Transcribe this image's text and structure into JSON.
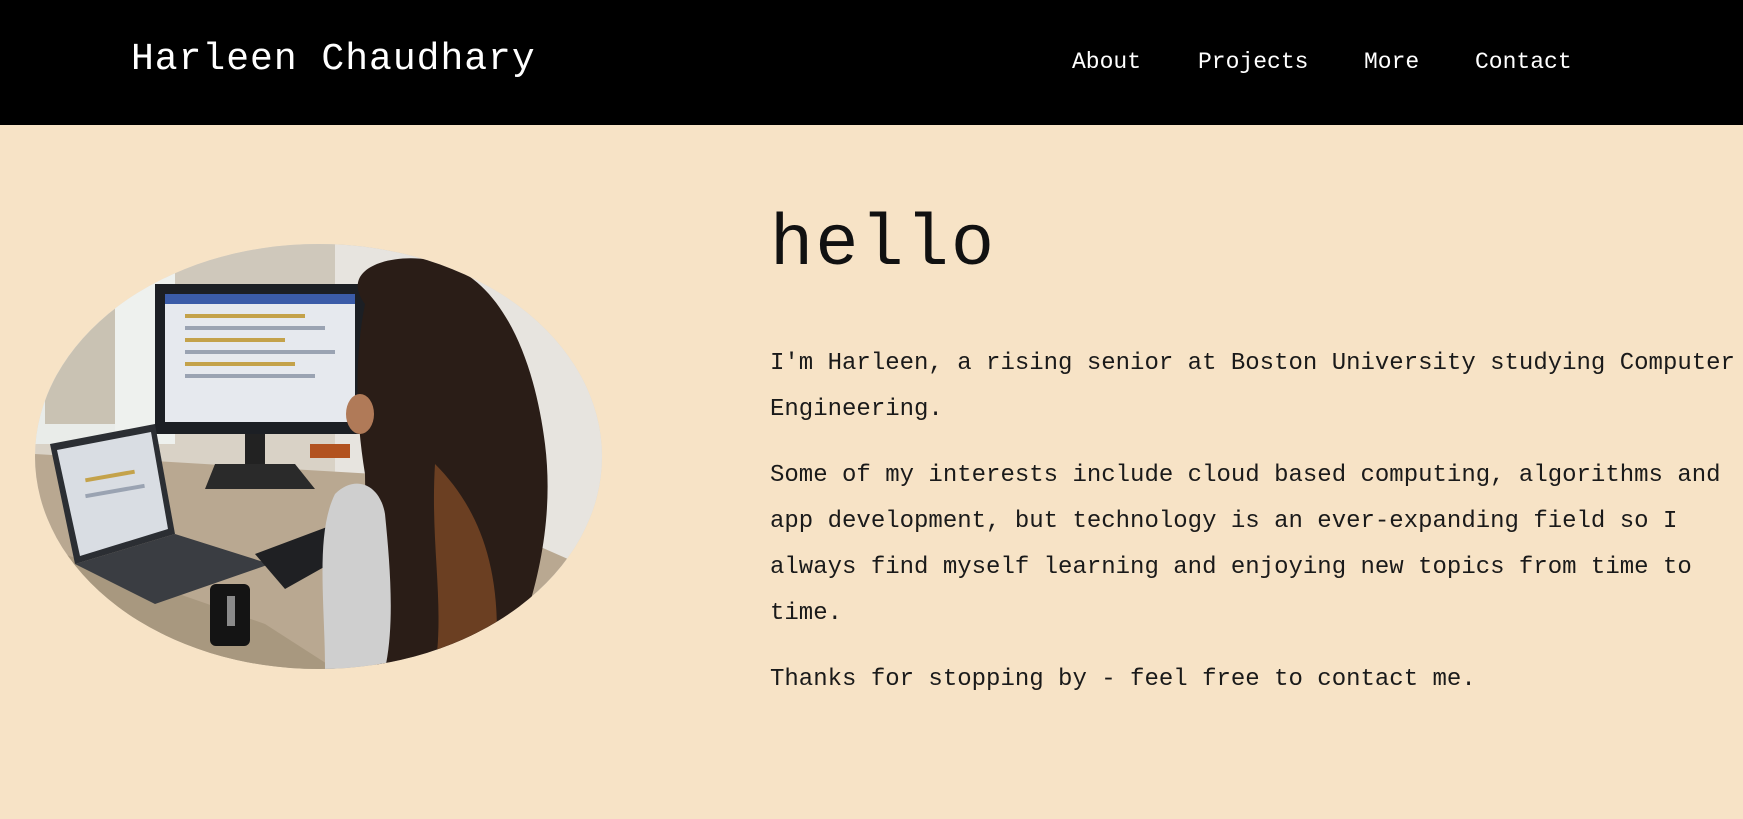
{
  "header": {
    "brand": "Harleen Chaudhary",
    "nav": [
      "About",
      "Projects",
      "More",
      "Contact"
    ]
  },
  "main": {
    "heading": "hello",
    "paragraphs": [
      "I'm Harleen, a rising senior at Boston University studying Computer Engineering.",
      "Some of my interests include cloud based computing, algorithms and app development, but technology is an ever-expanding field so I always find myself learning and enjoying new topics from time to time.",
      "Thanks for stopping by - feel free to contact me."
    ]
  },
  "colors": {
    "header_bg": "#000000",
    "page_bg": "#f7e3c6",
    "text": "#1a1a1a",
    "header_text": "#ffffff"
  }
}
